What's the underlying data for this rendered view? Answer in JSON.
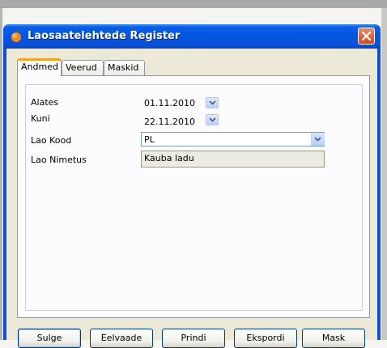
{
  "window": {
    "title": "Laosaatelehtede Register",
    "app_icon": "app-icon",
    "close_icon": "close-icon"
  },
  "tabs": [
    {
      "label": "Andmed",
      "active": true
    },
    {
      "label": "Veerud",
      "active": false
    },
    {
      "label": "Maskid",
      "active": false
    }
  ],
  "form": {
    "alates_label": "Alates",
    "alates_value": "01.11.2010",
    "kuni_label": "Kuni",
    "kuni_value": "22.11.2010",
    "lao_kood_label": "Lao Kood",
    "lao_kood_value": "PL",
    "lao_nimetus_label": "Lao Nimetus",
    "lao_nimetus_value": "Kauba ladu"
  },
  "buttons": {
    "sulge": "Sulge",
    "eelvaade": "Eelvaade",
    "prindi": "Prindi",
    "ekspordi": "Ekspordi",
    "mask": "Mask"
  },
  "colors": {
    "titlebar": "#0a51d6",
    "client_bg": "#ece9d8",
    "active_tab_accent": "#f5a522",
    "close_button": "#d0461c"
  }
}
